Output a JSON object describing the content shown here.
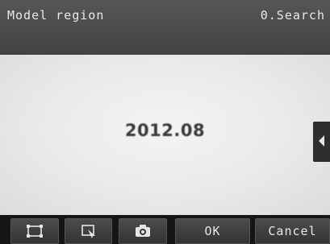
{
  "header": {
    "title": "Model region",
    "mode": "0.Search"
  },
  "viewport": {
    "image_text": "2012.08"
  },
  "panel_toggle": {
    "icon": "chevron-left-icon"
  },
  "toolbar": {
    "region_icon": "rectangle-region-icon",
    "edit_icon": "edit-region-icon",
    "capture_icon": "camera-icon",
    "ok_label": "OK",
    "cancel_label": "Cancel"
  }
}
